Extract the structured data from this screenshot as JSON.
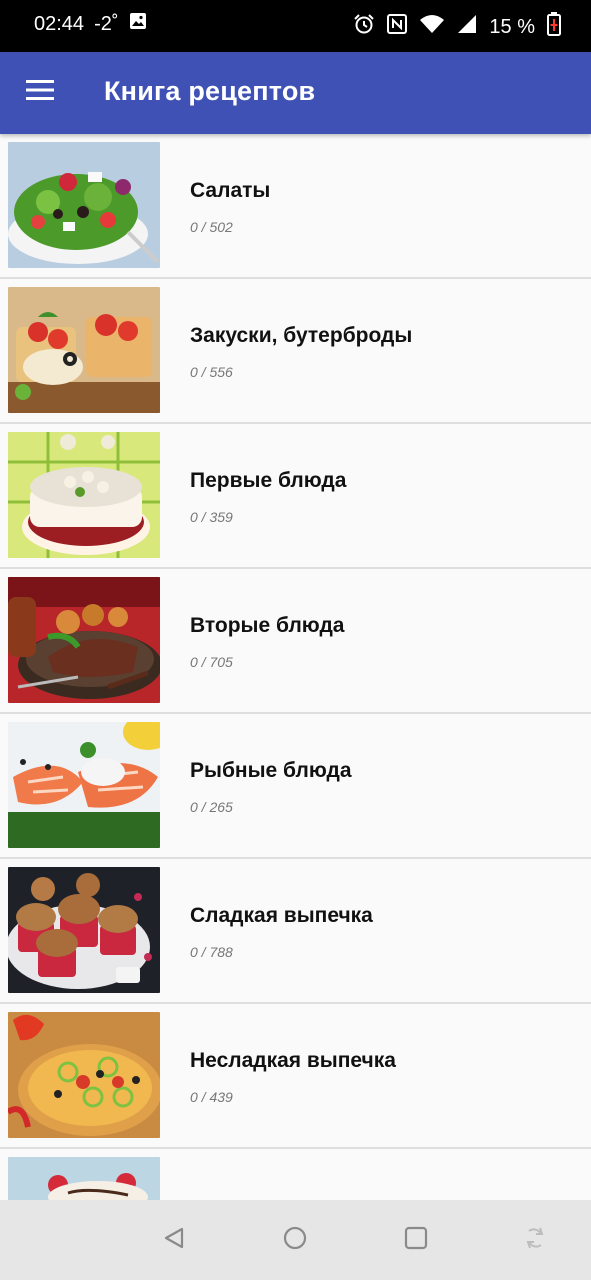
{
  "status_bar": {
    "time": "02:44",
    "temperature": "-2˚",
    "battery_percent": "15 %",
    "icons": [
      "image-icon",
      "alarm-icon",
      "nfc-icon",
      "wifi-icon",
      "signal-icon",
      "battery-icon"
    ]
  },
  "app_bar": {
    "title": "Книга рецептов",
    "menu_icon": "menu-icon",
    "background_color": "#3f51b5"
  },
  "categories": [
    {
      "title": "Салаты",
      "count": "0 / 502"
    },
    {
      "title": "Закуски, бутерброды",
      "count": "0 / 556"
    },
    {
      "title": "Первые блюда",
      "count": "0 / 359"
    },
    {
      "title": "Вторые блюда",
      "count": "0 / 705"
    },
    {
      "title": "Рыбные блюда",
      "count": "0 / 265"
    },
    {
      "title": "Сладкая выпечка",
      "count": "0 / 788"
    },
    {
      "title": "Несладкая выпечка",
      "count": "0 / 439"
    },
    {
      "title": "",
      "count": ""
    }
  ],
  "nav_bar": {
    "icons": [
      "back-icon",
      "home-icon",
      "recents-icon",
      "rotate-icon"
    ]
  }
}
